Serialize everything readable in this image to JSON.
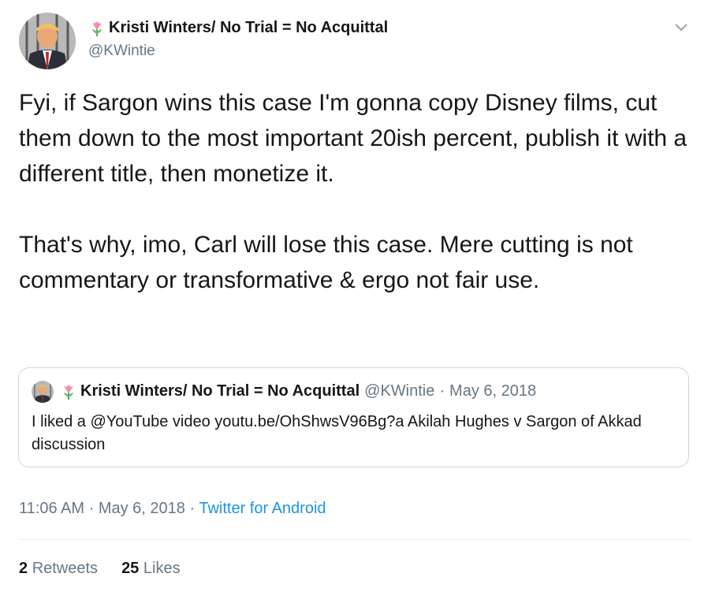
{
  "author": {
    "display_name": "Kristi Winters/ No Trial = No Acquittal",
    "handle": "@KWintie",
    "avatar": "avatar-photo",
    "name_emoji": "tulip-icon"
  },
  "tweet": {
    "paragraphs": [
      "Fyi, if Sargon wins this case I'm gonna copy Disney films, cut them down to the most important 20ish percent, publish it with a different title, then monetize it.",
      "That's why, imo, Carl will lose this case. Mere cutting is not commentary or transformative & ergo not fair use."
    ]
  },
  "quoted_tweet": {
    "display_name": "Kristi Winters/ No Trial = No Acquittal",
    "handle": "@KWintie",
    "separator": "·",
    "date": "May 6, 2018",
    "text": "I liked a @YouTube video youtu.be/OhShwsV96Bg?a Akilah Hughes v Sargon of Akkad discussion"
  },
  "meta": {
    "time": "11:06 AM",
    "separator": "·",
    "date": "May 6, 2018",
    "source": "Twitter for Android"
  },
  "stats": {
    "retweets_count": "2",
    "retweets_label": "Retweets",
    "likes_count": "25",
    "likes_label": "Likes"
  },
  "colors": {
    "link": "#1b95e0",
    "secondary_text": "#657786",
    "border": "#ccd6dd"
  }
}
